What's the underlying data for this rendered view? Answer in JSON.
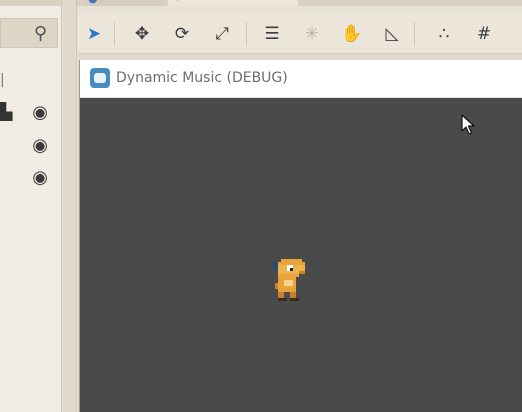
{
  "tabs": [
    {
      "icon": "script-icon",
      "label": ""
    },
    {
      "icon": "scene-icon",
      "label": ""
    }
  ],
  "left_dock": {
    "search_icon": "search-icon",
    "rows": [
      {
        "icon": "node-icon",
        "visibility_icon": "eye-icon"
      },
      {
        "icon": "",
        "visibility_icon": "eye-icon"
      },
      {
        "icon": "",
        "visibility_icon": "eye-icon"
      }
    ]
  },
  "toolbar": {
    "tools": [
      {
        "name": "select-tool",
        "glyph": "➤",
        "active": true
      },
      {
        "name": "move-tool",
        "glyph": "✥"
      },
      {
        "name": "rotate-tool",
        "glyph": "⟳"
      },
      {
        "name": "scale-tool",
        "glyph": "⤢"
      },
      {
        "name": "list-select-tool",
        "glyph": "☰"
      },
      {
        "name": "pivot-tool",
        "glyph": "✳",
        "dim": true
      },
      {
        "name": "pan-tool",
        "glyph": "✋"
      },
      {
        "name": "ruler-tool",
        "glyph": "◺"
      },
      {
        "name": "smart-snap-tool",
        "glyph": "∴"
      },
      {
        "name": "grid-snap-tool",
        "glyph": "#"
      }
    ]
  },
  "game_window": {
    "title": "Dynamic Music (DEBUG)",
    "background_color": "#4a4a4a"
  },
  "colors": {
    "accent": "#2b77c9",
    "editor_bg": "#ece6da",
    "godot_blue": "#478cbf",
    "dino_orange": "#e8a33a"
  }
}
